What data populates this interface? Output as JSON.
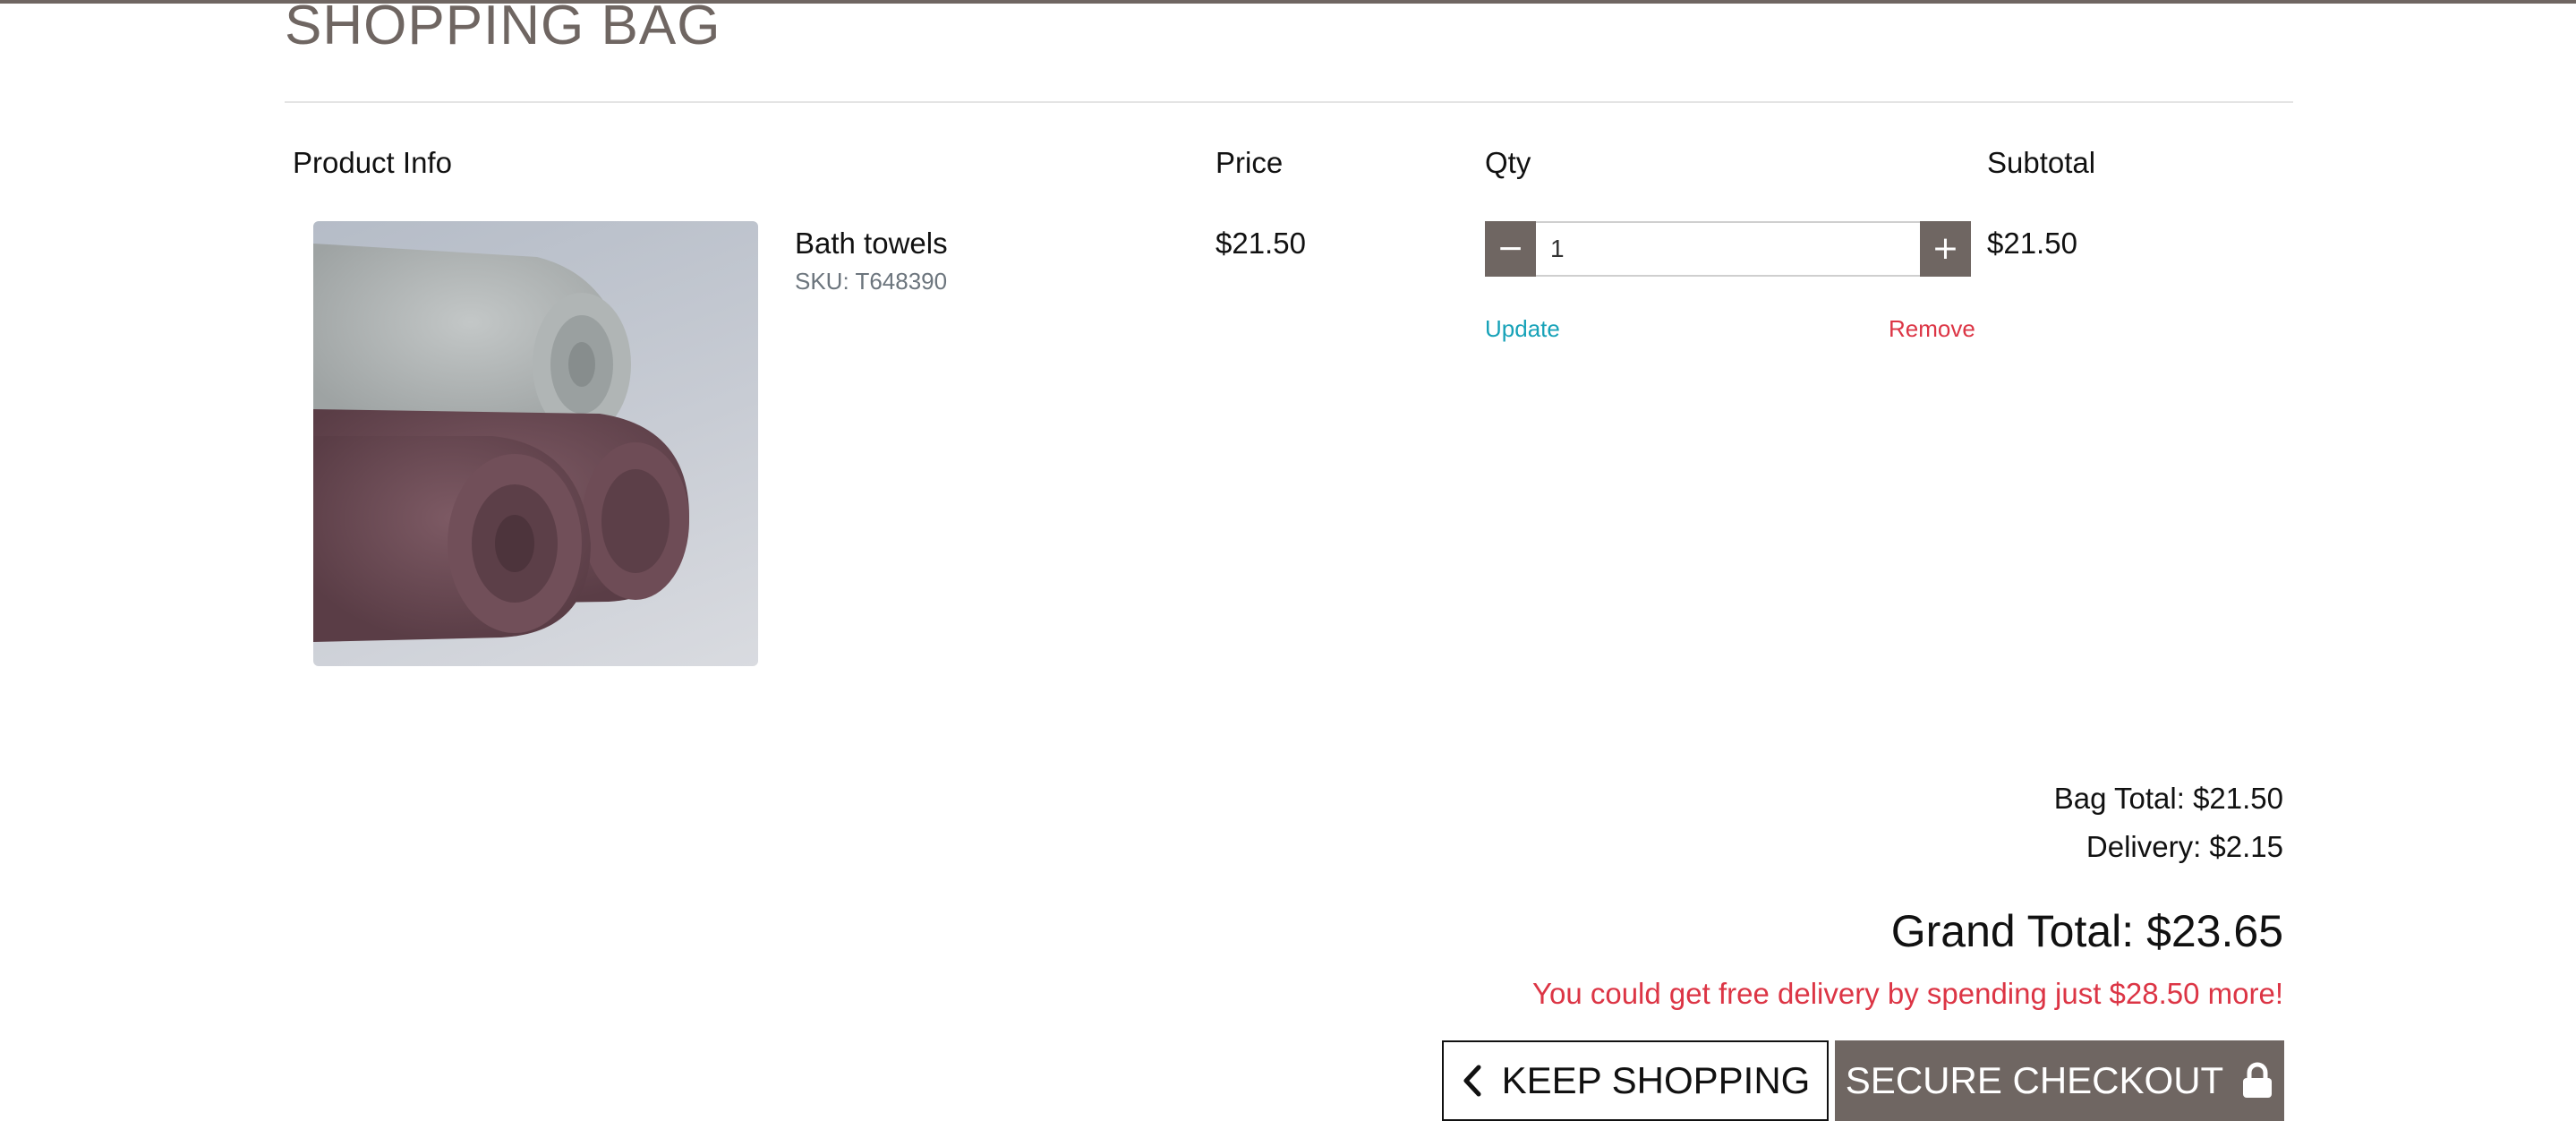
{
  "page": {
    "title": "SHOPPING BAG"
  },
  "table": {
    "headers": {
      "product_info": "Product Info",
      "price": "Price",
      "qty": "Qty",
      "subtotal": "Subtotal"
    },
    "items": [
      {
        "name": "Bath towels",
        "sku": "SKU: T648390",
        "price": "$21.50",
        "qty": "1",
        "subtotal": "$21.50",
        "decrement_symbol": "−",
        "increment_symbol": "+",
        "update_label": "Update",
        "remove_label": "Remove"
      }
    ]
  },
  "summary": {
    "bag_total": "Bag Total: $21.50",
    "delivery": "Delivery: $2.15",
    "grand_total": "Grand Total: $23.65",
    "free_delivery_message": "You could get free delivery by spending just $28.50 more!"
  },
  "actions": {
    "keep_shopping": "KEEP SHOPPING",
    "secure_checkout": "SECURE CHECKOUT"
  },
  "icons": {
    "keep_shopping_icon": "chevron-left-icon",
    "checkout_icon": "lock-icon",
    "product_image": "rolled-towels-image"
  },
  "colors": {
    "brand": "#6f6662",
    "update_link": "#17a2b8",
    "remove_link": "#dc3545",
    "warning_text": "#dc3545"
  }
}
